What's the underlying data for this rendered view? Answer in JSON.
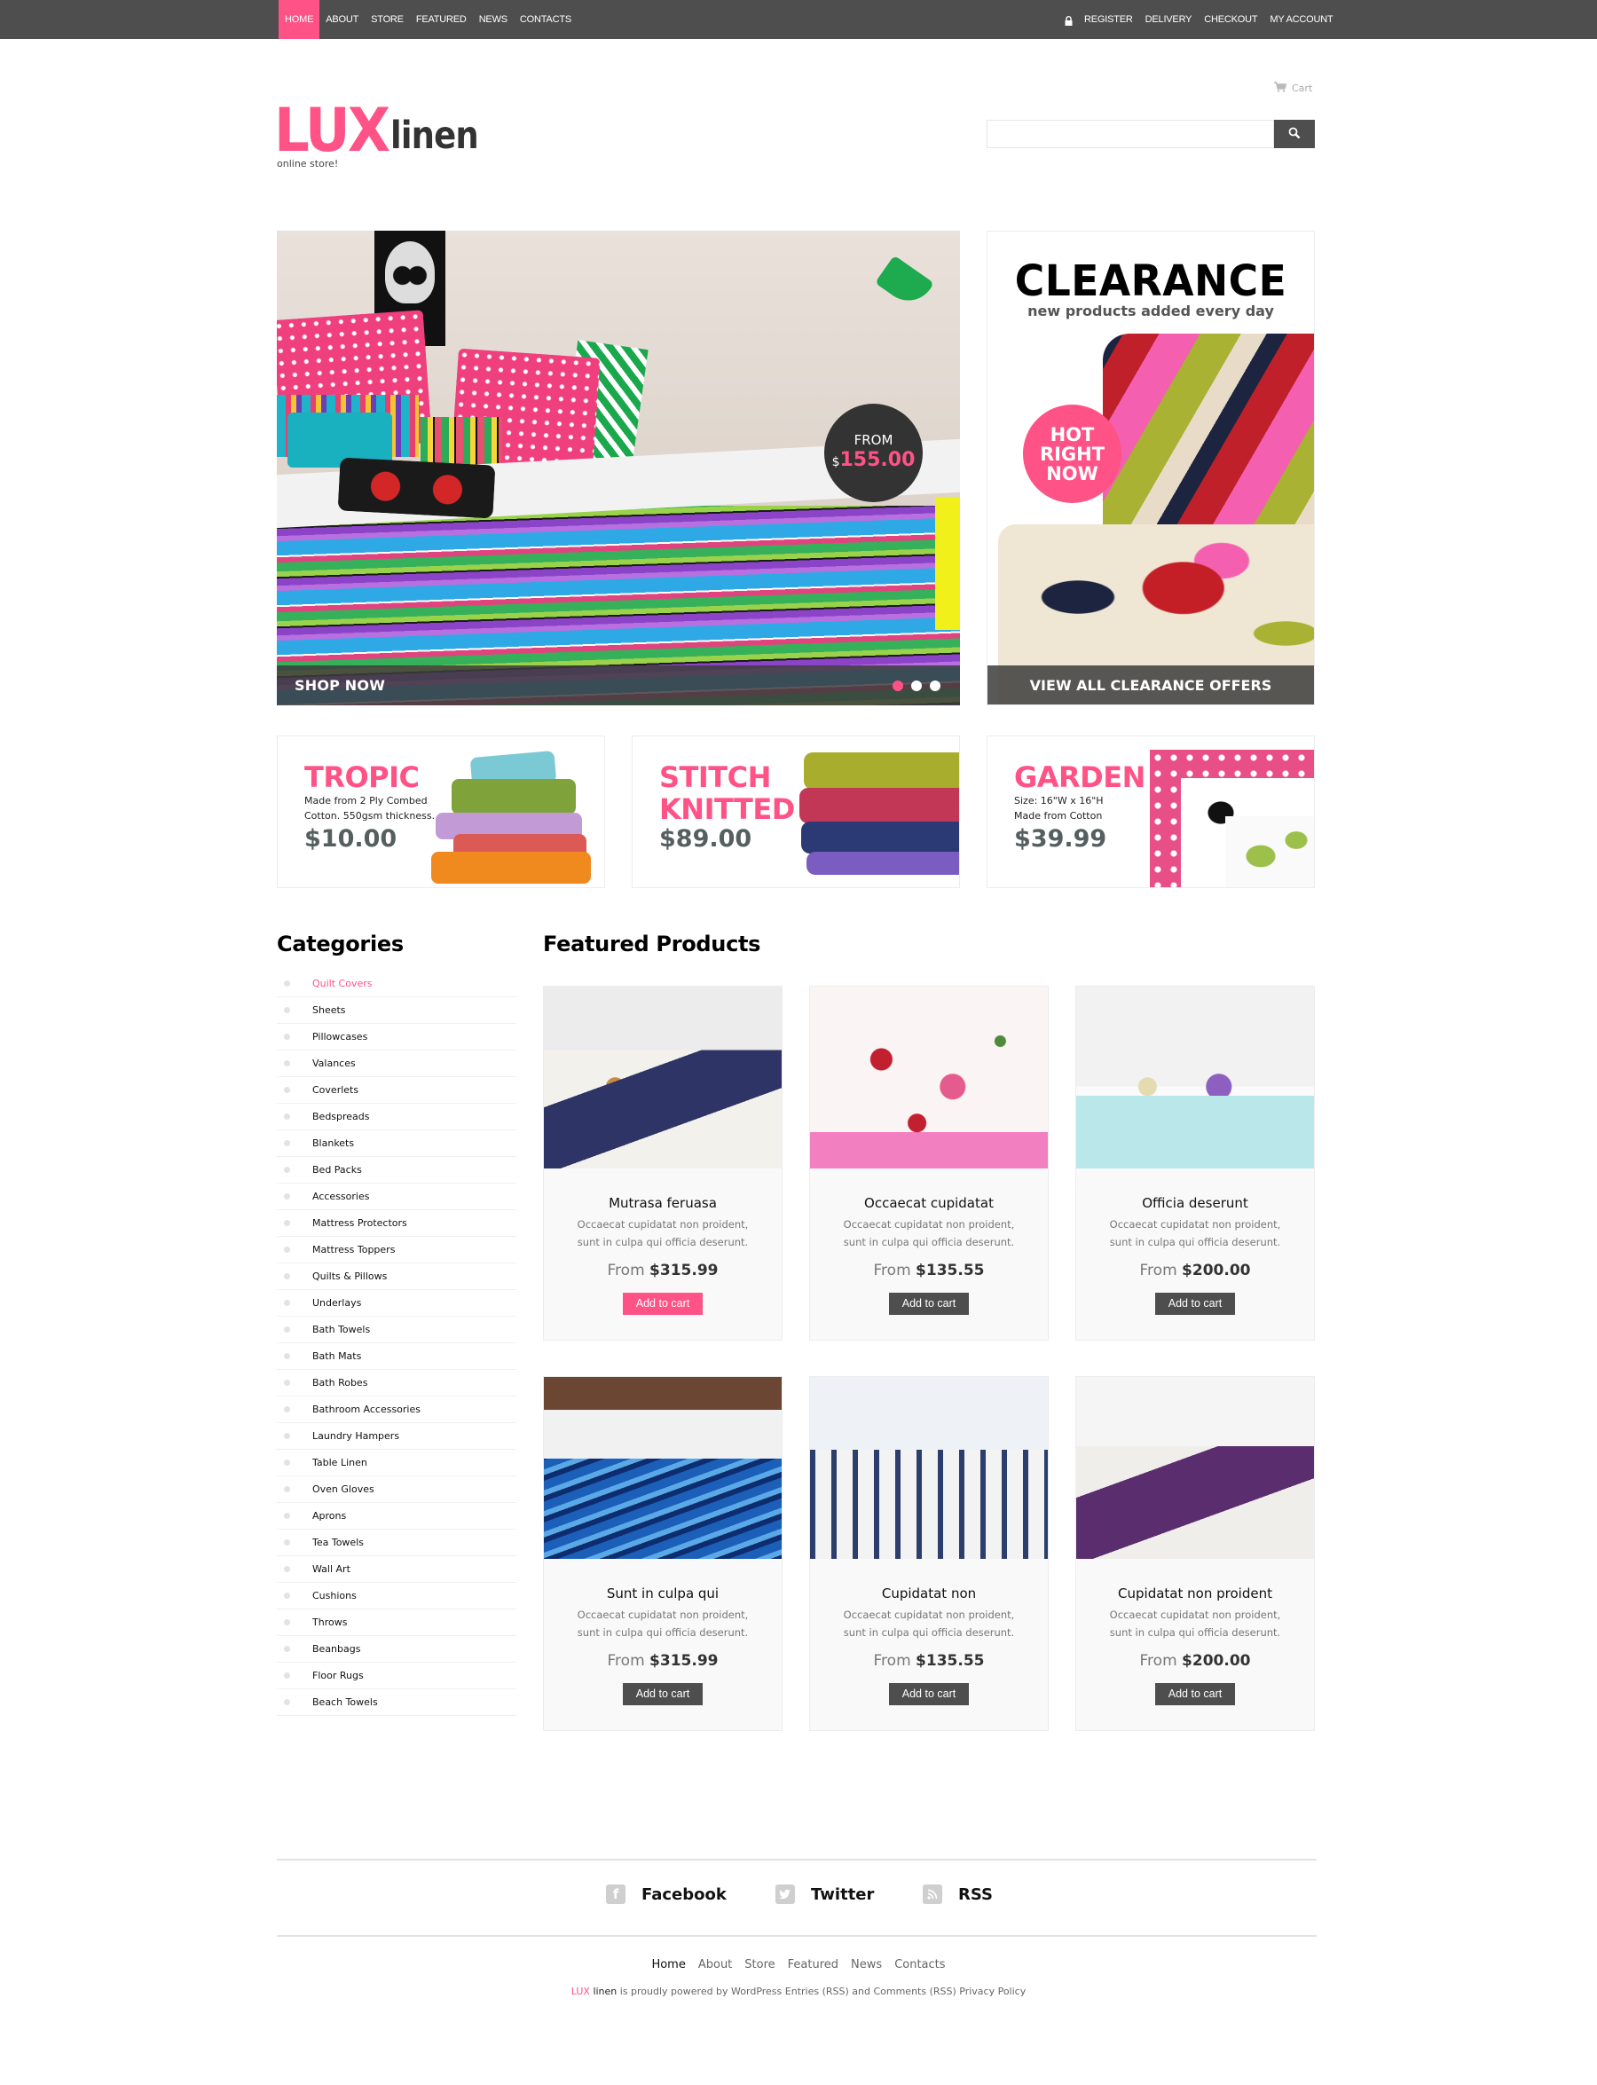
{
  "topnav": {
    "left": [
      {
        "label": "HOME",
        "active": true
      },
      {
        "label": "ABOUT"
      },
      {
        "label": "STORE"
      },
      {
        "label": "FEATURED"
      },
      {
        "label": "NEWS"
      },
      {
        "label": "CONTACTS"
      }
    ],
    "right": [
      {
        "label": "REGISTER"
      },
      {
        "label": "DELIVERY"
      },
      {
        "label": "CHECKOUT"
      },
      {
        "label": "MY ACCOUNT"
      }
    ]
  },
  "header": {
    "logo_part1": "LUX",
    "logo_part2": "linen",
    "tagline": "online store!",
    "cart_label": "Cart",
    "search_value": "",
    "search_placeholder": ""
  },
  "slider": {
    "cta": "SHOP NOW",
    "price_prefix": "FROM",
    "price_currency": "$",
    "price_amount": "155.00",
    "slides_total": 3,
    "active_slide": 1
  },
  "clearance": {
    "title": "CLEARANCE",
    "subtitle": "new products added  every day",
    "badge": "HOT\nRIGHT\nNOW",
    "cta": "VIEW ALL CLEARANCE OFFERS"
  },
  "promos": [
    {
      "title": "TROPIC",
      "desc": [
        "Made from 2 Ply Combed",
        "Cotton. 550gsm thickness."
      ],
      "price": "$10.00"
    },
    {
      "title": "STITCH KNITTED",
      "title_lines": [
        "STITCH",
        "KNITTED"
      ],
      "desc": [],
      "price": "$89.00"
    },
    {
      "title": "GARDEN",
      "desc": [
        "Size: 16\"W x 16\"H",
        "Made from Cotton"
      ],
      "price": "$39.99"
    }
  ],
  "categories": {
    "heading": "Categories",
    "items": [
      "Quilt Covers",
      "Sheets",
      "Pillowcases",
      "Valances",
      "Coverlets",
      "Bedspreads",
      "Blankets",
      "Bed Packs",
      "Accessories",
      "Mattress Protectors",
      "Mattress Toppers",
      "Quilts & Pillows",
      "Underlays",
      "Bath Towels",
      "Bath Mats",
      "Bath Robes",
      "Bathroom Accessories",
      "Laundry Hampers",
      "Table Linen",
      "Oven Gloves",
      "Aprons",
      "Tea Towels",
      "Wall Art",
      "Cushions",
      "Throws",
      "Beanbags",
      "Floor Rugs",
      "Beach Towels"
    ],
    "active_index": 0
  },
  "featured": {
    "heading": "Featured Products",
    "price_prefix": "From",
    "button_label": "Add to cart",
    "products": [
      {
        "name": "Mutrasa feruasa",
        "desc1": "Occaecat cupidatat non proident,",
        "desc2": "sunt in culpa qui officia deserunt.",
        "price": "$315.99",
        "highlight": true
      },
      {
        "name": "Occaecat cupidatat",
        "desc1": "Occaecat cupidatat non proident,",
        "desc2": "sunt in culpa qui officia deserunt.",
        "price": "$135.55"
      },
      {
        "name": "Officia deserunt",
        "desc1": "Occaecat cupidatat non proident,",
        "desc2": "sunt in culpa qui officia deserunt.",
        "price": "$200.00"
      },
      {
        "name": "Sunt in culpa qui",
        "desc1": "Occaecat cupidatat non proident,",
        "desc2": "sunt in culpa qui officia deserunt.",
        "price": "$315.99"
      },
      {
        "name": "Cupidatat non",
        "desc1": "Occaecat cupidatat non proident,",
        "desc2": "sunt in culpa qui officia deserunt.",
        "price": "$135.55"
      },
      {
        "name": "Cupidatat non proident",
        "desc1": "Occaecat cupidatat non proident,",
        "desc2": "sunt in culpa qui officia deserunt.",
        "price": "$200.00"
      }
    ]
  },
  "footer": {
    "social": [
      {
        "label": "Facebook",
        "icon": "facebook-icon"
      },
      {
        "label": "Twitter",
        "icon": "twitter-icon"
      },
      {
        "label": "RSS",
        "icon": "rss-icon"
      }
    ],
    "nav": [
      "Home",
      "About",
      "Store",
      "Featured",
      "News",
      "Contacts"
    ],
    "credit_lux": "LUX",
    "credit_linen": "linen",
    "credit_text": " is proudly powered by WordPress Entries (RSS) and Comments (RSS) Privacy Policy"
  },
  "colors": {
    "accent": "#ff5286",
    "topbar": "#4e4e4e",
    "dark_button": "#4e4e4e"
  }
}
